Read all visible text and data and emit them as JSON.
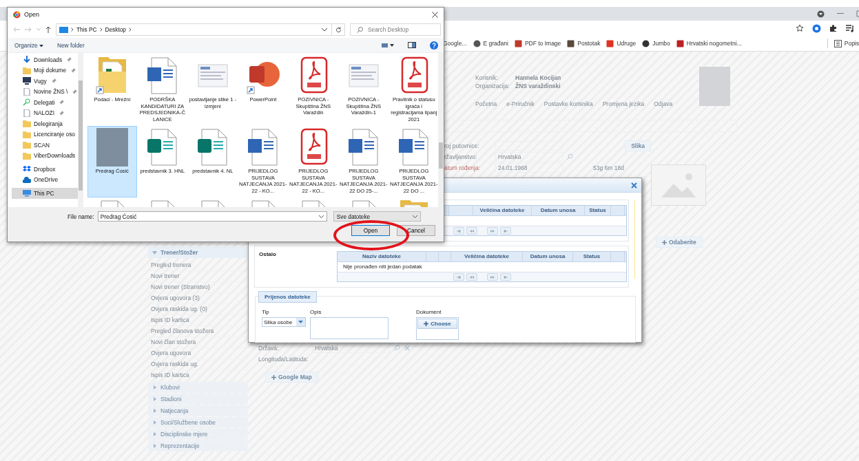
{
  "browser": {
    "bookmarks": [
      {
        "label": "Google..."
      },
      {
        "label": "E građani"
      },
      {
        "label": "PDF to Image"
      },
      {
        "label": "Postotak"
      },
      {
        "label": "Udruge"
      },
      {
        "label": "Jumbo"
      },
      {
        "label": "Hrvatski nogometni..."
      }
    ],
    "reading_list": "Popis"
  },
  "page": {
    "user_label": "Korisnik:",
    "user": "Hannela Kocijan",
    "org_label": "Organizacija:",
    "org": "ŽNS varaždinski",
    "nav": [
      "Početna",
      "e-Priručnik",
      "Postavke korisnika",
      "Promjena jezika",
      "Odjava"
    ],
    "form": [
      {
        "label": "roj putovnice:",
        "error": false
      },
      {
        "label": "ržavljanstvo:",
        "value": "Hrvatska",
        "error": false
      },
      {
        "label": "atum rođenja:",
        "value": "24.01.1968",
        "error": true
      }
    ],
    "age": "53g 6m 18d",
    "picture_button": "Slika",
    "choose_button": "Odaberite",
    "sidebar": {
      "section": "Trener/Stožer",
      "items": [
        {
          "label": "Pregled trenera"
        },
        {
          "label": "Novi trener"
        },
        {
          "label": "Novi trener (Stranstvo)"
        },
        {
          "label": "Ovjera ugovora (3)"
        },
        {
          "label": "Ovjera raskida ug. (0)"
        },
        {
          "label": "Ispis ID kartica"
        },
        {
          "label": "Pregled članova stožera"
        },
        {
          "label": "Novi član stožera"
        },
        {
          "label": "Ovjera ugovora"
        },
        {
          "label": "Ovjera raskida ug."
        },
        {
          "label": "Ispis ID kartica"
        }
      ],
      "groups": [
        "Klubovi",
        "Stadioni",
        "Natjecanja",
        "Suci/Službene osobe",
        "Disciplinske mjere",
        "Reprezentacije"
      ]
    },
    "country_label": "Država:",
    "country": "Hrvatska",
    "coords_label": "Longituda/Latituda:",
    "map_button": "Google Map"
  },
  "upload_dialog": {
    "table_1": {
      "columns": [
        "Veličina datoteke",
        "Datum unosa",
        "Status"
      ]
    },
    "other": {
      "title": "Ostalo",
      "columns": [
        "Naziv datoteke",
        "Veličina datoteke",
        "Datum unosa",
        "Status"
      ],
      "empty_message": "Nije pronađen niti jedan podatak"
    },
    "upload": {
      "legend": "Prijenos datoteke",
      "type_label": "Tip",
      "type_value": "Slika osobe",
      "description_label": "Opis",
      "document_label": "Dokument",
      "choose_button": "Choose"
    }
  },
  "file_dialog": {
    "title": "Open",
    "path": [
      "This PC",
      "Desktop"
    ],
    "search_placeholder": "Search Desktop",
    "toolbar": [
      "Organize",
      "New folder"
    ],
    "nav": [
      {
        "label": "Downloads",
        "kind": "download",
        "pinned": true,
        "selected": false
      },
      {
        "label": "Moji dokume",
        "kind": "folder",
        "pinned": true,
        "selected": false
      },
      {
        "label": "Vugy",
        "kind": "computer",
        "pinned": true,
        "selected": false
      },
      {
        "label": "Novine ŽNS \\",
        "kind": "doc",
        "pinned": true,
        "selected": false
      },
      {
        "label": "Delegati",
        "kind": "search",
        "pinned": true,
        "selected": false
      },
      {
        "label": "NALOZI",
        "kind": "doc",
        "pinned": true,
        "selected": false
      },
      {
        "label": "Delegiranja",
        "kind": "folder",
        "pinned": false,
        "selected": false
      },
      {
        "label": "Licenciranje oso",
        "kind": "folder",
        "pinned": false,
        "selected": false
      },
      {
        "label": "SCAN",
        "kind": "folder",
        "pinned": false,
        "selected": false
      },
      {
        "label": "ViberDownloads",
        "kind": "folder",
        "pinned": false,
        "selected": false
      },
      {
        "label": "Dropbox",
        "kind": "dropbox",
        "pinned": false,
        "selected": false
      },
      {
        "label": "OneDrive",
        "kind": "cloud",
        "pinned": false,
        "selected": false
      },
      {
        "label": "This PC",
        "kind": "pc",
        "pinned": false,
        "selected": true
      }
    ],
    "files": [
      {
        "label": "Podaci - Mrežni",
        "kind": "folder",
        "shortcut": true,
        "selected": false
      },
      {
        "label": "PODRŠKA KANDIDATURI ZA PREDSJEDNIKA-Č LANICE",
        "kind": "word",
        "shortcut": false,
        "selected": false
      },
      {
        "label": "postavljanje slike 1 - izmjeni",
        "kind": "image",
        "shortcut": false,
        "selected": false
      },
      {
        "label": "PowerPoint",
        "kind": "powerpoint",
        "shortcut": true,
        "selected": false
      },
      {
        "label": "POZIVNICA - Skupština ŽNS Varaždin",
        "kind": "pdf",
        "shortcut": false,
        "selected": false
      },
      {
        "label": "POZIVNICA - Skupština ŽNS Varaždin-1",
        "kind": "image",
        "shortcut": false,
        "selected": false
      },
      {
        "label": "Pravilnik o statusu igrača i registracijama lipanj 2021",
        "kind": "pdf",
        "shortcut": false,
        "selected": false
      },
      {
        "label": "Predrag Ćosić",
        "kind": "photo",
        "shortcut": false,
        "selected": true
      },
      {
        "label": "predstavnik 3. HNL",
        "kind": "publisher",
        "shortcut": false,
        "selected": false
      },
      {
        "label": "predstavnik 4. NL",
        "kind": "publisher",
        "shortcut": false,
        "selected": false
      },
      {
        "label": "PRIJEDLOG SUSTAVA NATJECANJA 2021-22 - KO...",
        "kind": "word",
        "shortcut": false,
        "selected": false
      },
      {
        "label": "PRIJEDLOG SUSTAVA NATJECANJA 2021-22 - KO...",
        "kind": "pdf",
        "shortcut": false,
        "selected": false
      },
      {
        "label": "PRIJEDLOG SUSTAVA NATJECANJA 2021-22 DO 25-...",
        "kind": "word",
        "shortcut": false,
        "selected": false
      },
      {
        "label": "PRIJEDLOG SUSTAVA NATJECANJA 2021-22 DO ...",
        "kind": "word",
        "shortcut": false,
        "selected": false
      },
      {
        "kind": "blank",
        "selected": false
      },
      {
        "kind": "blank",
        "selected": false
      },
      {
        "kind": "blank",
        "selected": false
      },
      {
        "kind": "blank",
        "selected": false
      },
      {
        "kind": "blank",
        "selected": false
      },
      {
        "kind": "blank",
        "selected": false
      },
      {
        "kind": "folder",
        "selected": false
      }
    ],
    "file_name_label": "File name:",
    "file_name": "Predrag Ćosić",
    "filter": "Sve datoteke",
    "buttons": [
      {
        "label": "Open",
        "default": true
      },
      {
        "label": "Cancel",
        "default": false
      }
    ]
  }
}
